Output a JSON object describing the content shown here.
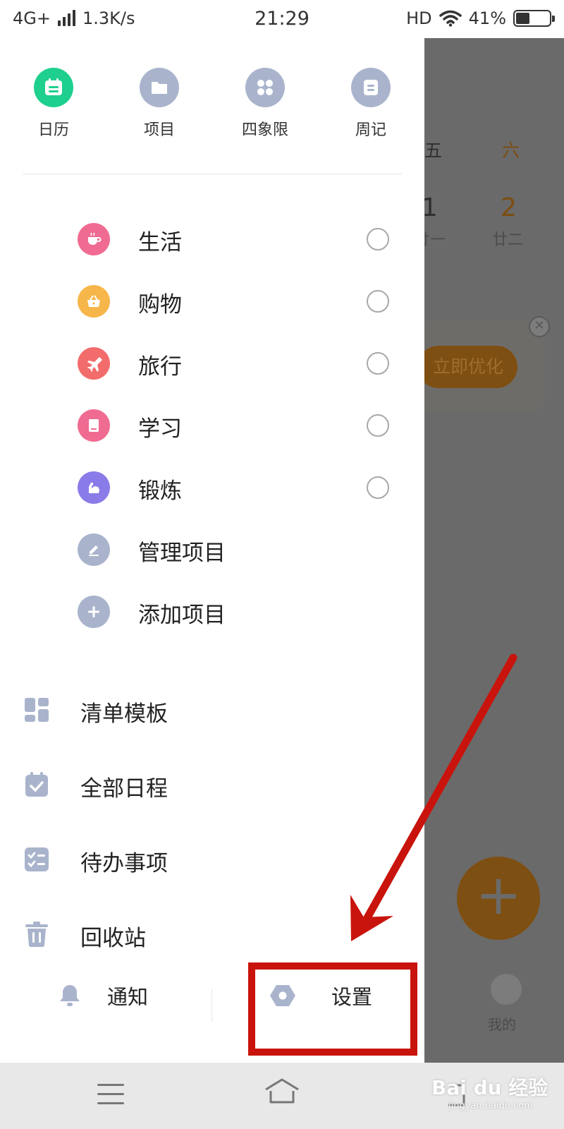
{
  "status": {
    "network": "4G+",
    "speed": "1.3K/s",
    "time": "21:29",
    "hd": "HD",
    "battery": "41%",
    "battery_level": 0.41
  },
  "background": {
    "weekday_fri": "五",
    "weekday_sat": "六",
    "day_fri": "1",
    "day_sat": "2",
    "lunar_fri": "廿一",
    "lunar_sat": "廿二",
    "optimize_button": "立即优化",
    "add_button": "+",
    "tab_me": "我的",
    "accent_color": "#f08a0c"
  },
  "drawer": {
    "top_tiles": [
      {
        "label": "日历",
        "color": "#1ecf8e"
      },
      {
        "label": "项目",
        "color": "#a9b4cc"
      },
      {
        "label": "四象限",
        "color": "#a9b4cc"
      },
      {
        "label": "周记",
        "color": "#a9b4cc"
      }
    ],
    "projects": [
      {
        "label": "生活",
        "color": "#f06b91",
        "icon": "cup-icon"
      },
      {
        "label": "购物",
        "color": "#f7b64a",
        "icon": "basket-icon"
      },
      {
        "label": "旅行",
        "color": "#f36c6c",
        "icon": "plane-icon"
      },
      {
        "label": "学习",
        "color": "#f06b91",
        "icon": "book-icon"
      },
      {
        "label": "锻炼",
        "color": "#8a7ce8",
        "icon": "muscle-icon"
      }
    ],
    "manage_project": "管理项目",
    "add_project": "添加项目",
    "menu": [
      {
        "label": "清单模板",
        "icon": "template-icon"
      },
      {
        "label": "全部日程",
        "icon": "calendar-check-icon"
      },
      {
        "label": "待办事项",
        "icon": "todo-list-icon"
      },
      {
        "label": "回收站",
        "icon": "trash-icon"
      }
    ],
    "notify": "通知",
    "settings": "设置",
    "icon_gray": "#a9b4cc"
  },
  "watermark": {
    "main": "Bai du 经验",
    "sub": "jingyan.baidu.com"
  }
}
